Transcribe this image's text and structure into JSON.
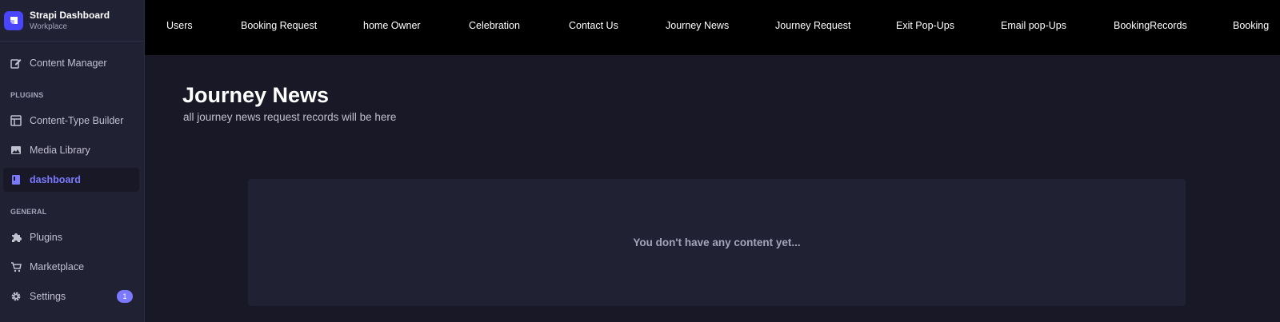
{
  "brand": {
    "title": "Strapi Dashboard",
    "subtitle": "Workplace"
  },
  "sidebar": {
    "content_manager": "Content Manager",
    "plugins_label": "PLUGINS",
    "content_type_builder": "Content-Type Builder",
    "media_library": "Media Library",
    "dashboard": "dashboard",
    "general_label": "GENERAL",
    "plugins": "Plugins",
    "marketplace": "Marketplace",
    "settings": "Settings",
    "settings_badge": "1"
  },
  "topnav": {
    "items": [
      "Users",
      "Booking Request",
      "home Owner",
      "Celebration",
      "Contact Us",
      "Journey News",
      "Journey Request",
      "Exit Pop-Ups",
      "Email pop-Ups",
      "BookingRecords",
      "Booking"
    ]
  },
  "main": {
    "title": "Journey News",
    "subtitle": "all journey news request records will be here",
    "empty_message": "You don't have any content yet..."
  },
  "colors": {
    "accent": "#4945ff",
    "active": "#7b79ff",
    "background": "#181826",
    "panel": "#212134",
    "topbar": "#000000"
  }
}
